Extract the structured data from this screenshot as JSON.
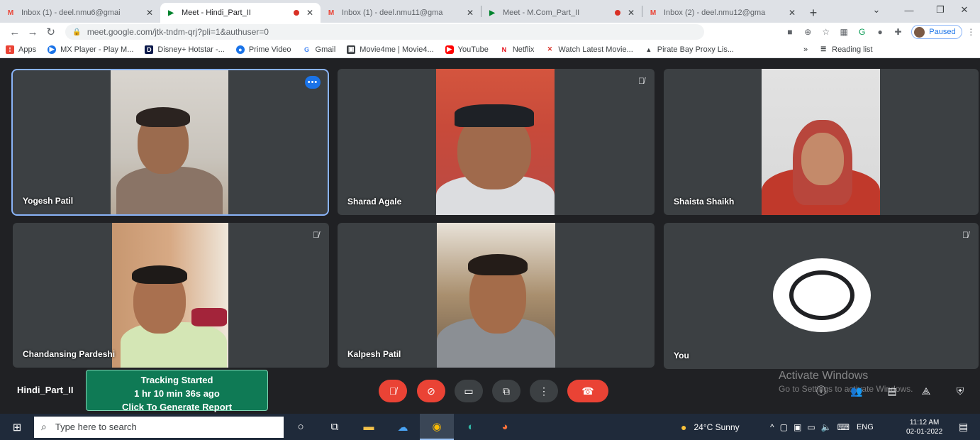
{
  "browser": {
    "tabs": [
      {
        "icon": "gmail-icon",
        "title": "Inbox (1) - deel.nmu6@gmai",
        "recording": false,
        "active": false
      },
      {
        "icon": "meet-icon",
        "title": "Meet - Hindi_Part_II",
        "recording": true,
        "active": true
      },
      {
        "icon": "gmail-icon",
        "title": "Inbox (1) - deel.nmu11@gma",
        "recording": false,
        "active": false
      },
      {
        "icon": "meet-icon",
        "title": "Meet - M.Com_Part_II",
        "recording": true,
        "active": false
      },
      {
        "icon": "gmail-icon",
        "title": "Inbox (2) - deel.nmu12@gma",
        "recording": false,
        "active": false
      }
    ],
    "new_tab": "+",
    "url": "meet.google.com/jtk-tndm-qrj?pli=1&authuser=0",
    "profile_status": "Paused",
    "bookmarks": [
      {
        "label": "Apps",
        "icon": "apps-icon",
        "color": "#ea4335"
      },
      {
        "label": "MX Player - Play M...",
        "icon": "mx-player-icon",
        "color": "#1a73e8"
      },
      {
        "label": "Disney+ Hotstar -...",
        "icon": "hotstar-icon",
        "color": "#0c1a4b"
      },
      {
        "label": "Prime Video",
        "icon": "prime-video-icon",
        "color": "#1a73e8"
      },
      {
        "label": "Gmail",
        "icon": "google-icon",
        "color": "#4285f4"
      },
      {
        "label": "Movie4me | Movie4...",
        "icon": "movie-icon",
        "color": "#3c4043"
      },
      {
        "label": "YouTube",
        "icon": "youtube-icon",
        "color": "#ff0000"
      },
      {
        "label": "Netflix",
        "icon": "netflix-icon",
        "color": "#e50914"
      },
      {
        "label": "Watch Latest Movie...",
        "icon": "watch-icon",
        "color": "#d93025"
      },
      {
        "label": "Pirate Bay Proxy Lis...",
        "icon": "pirate-icon",
        "color": "#3c4043"
      }
    ],
    "reading_list": "Reading list"
  },
  "meet": {
    "participants": [
      {
        "name": "Yogesh Patil",
        "muted": false,
        "pinned": true
      },
      {
        "name": "Sharad Agale",
        "muted": true,
        "pinned": false
      },
      {
        "name": "Shaista Shaikh",
        "muted": false,
        "pinned": false
      },
      {
        "name": "Chandansing Pardeshi",
        "muted": true,
        "pinned": false
      },
      {
        "name": "Kalpesh Patil",
        "muted": false,
        "pinned": false
      },
      {
        "name": "You",
        "muted": true,
        "pinned": false
      }
    ],
    "meeting_name": "Hindi_Part_II",
    "tracker": {
      "line1": "Tracking Started",
      "line2": "1 hr 10 min 36s ago",
      "line3": "Click To Generate Report"
    },
    "watermark": {
      "title": "Activate Windows",
      "subtitle": "Go to Settings to activate Windows."
    },
    "accent": "#1a73e8",
    "danger": "#ea4335"
  },
  "taskbar": {
    "search_placeholder": "Type here to search",
    "weather": "24°C  Sunny",
    "language": "ENG",
    "time": "11:12 AM",
    "date": "02-01-2022"
  }
}
